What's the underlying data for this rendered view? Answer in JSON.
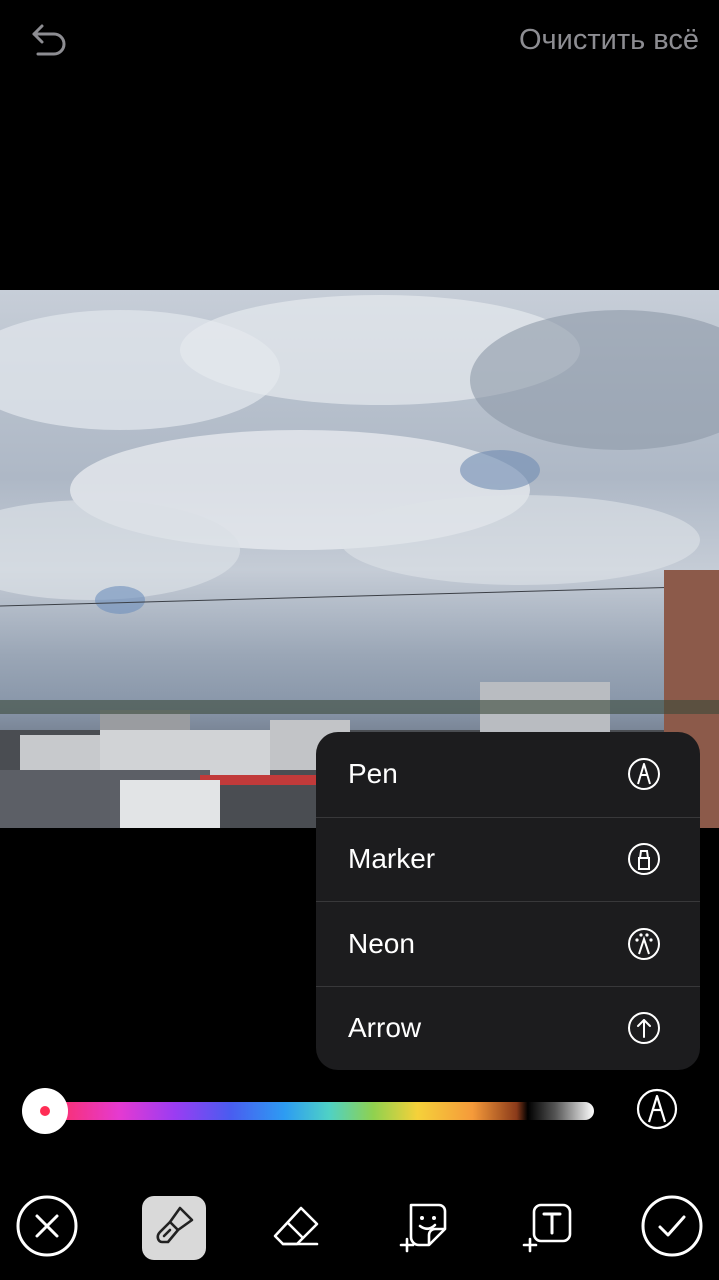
{
  "header": {
    "clear_all_label": "Очистить всё",
    "undo_icon": "undo-arrow-icon"
  },
  "brush_menu": {
    "items": [
      {
        "label": "Pen",
        "icon": "pen-icon"
      },
      {
        "label": "Marker",
        "icon": "marker-icon"
      },
      {
        "label": "Neon",
        "icon": "neon-icon"
      },
      {
        "label": "Arrow",
        "icon": "arrow-up-icon"
      }
    ]
  },
  "color_picker": {
    "selected_color": "#ff2d55",
    "selected_position": 0.0
  },
  "bottom_toolbar": {
    "items": [
      {
        "name": "close",
        "icon": "close-icon"
      },
      {
        "name": "draw",
        "icon": "brush-icon",
        "active": true
      },
      {
        "name": "eraser",
        "icon": "eraser-icon"
      },
      {
        "name": "sticker",
        "icon": "sticker-icon"
      },
      {
        "name": "text",
        "icon": "text-icon"
      },
      {
        "name": "done",
        "icon": "checkmark-icon"
      }
    ]
  },
  "colors": {
    "background": "#000000",
    "menu_background": "#1c1c1e",
    "muted_text": "#8d8d92",
    "accent_red": "#ff2d55"
  }
}
